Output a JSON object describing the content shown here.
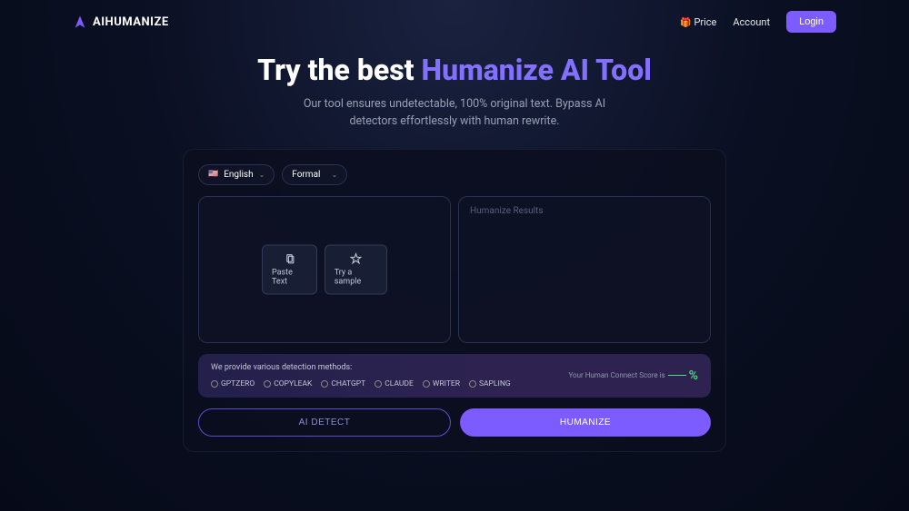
{
  "header": {
    "logo_text": "AIHUMANIZE",
    "nav": {
      "price_label": "Price",
      "account_label": "Account",
      "login_label": "Login"
    }
  },
  "hero": {
    "title_plain": "Try the best ",
    "title_accent": "Humanize AI Tool",
    "subtitle_line1": "Our tool ensures undetectable, 100% original text. Bypass AI",
    "subtitle_line2": "detectors effortlessly with human rewrite."
  },
  "controls": {
    "language_label": "English",
    "tone_label": "Formal"
  },
  "input_panel": {
    "paste_label": "Paste Text",
    "sample_label": "Try a sample"
  },
  "output_panel": {
    "placeholder": "Humanize Results"
  },
  "detection": {
    "title": "We provide various detection methods:",
    "methods": [
      "GPTZERO",
      "COPYLEAK",
      "CHATGPT",
      "CLAUDE",
      "WRITER",
      "SAPLING"
    ],
    "score_label": "Your Human Connect Score is",
    "score_symbol": "%"
  },
  "actions": {
    "detect_label": "AI DETECT",
    "humanize_label": "HUMANIZE"
  }
}
